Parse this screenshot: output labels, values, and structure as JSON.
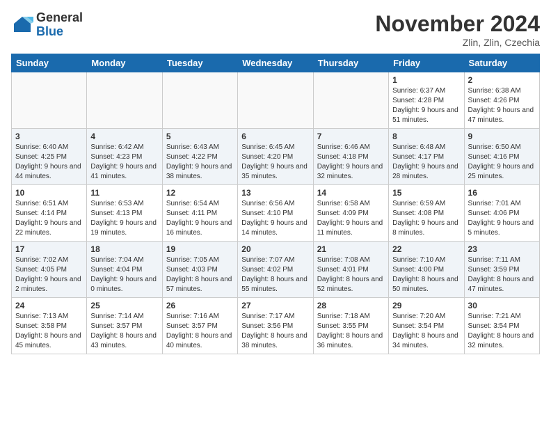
{
  "logo": {
    "general": "General",
    "blue": "Blue"
  },
  "title": "November 2024",
  "location": "Zlin, Zlin, Czechia",
  "days_of_week": [
    "Sunday",
    "Monday",
    "Tuesday",
    "Wednesday",
    "Thursday",
    "Friday",
    "Saturday"
  ],
  "weeks": [
    [
      {
        "day": "",
        "info": ""
      },
      {
        "day": "",
        "info": ""
      },
      {
        "day": "",
        "info": ""
      },
      {
        "day": "",
        "info": ""
      },
      {
        "day": "",
        "info": ""
      },
      {
        "day": "1",
        "info": "Sunrise: 6:37 AM\nSunset: 4:28 PM\nDaylight: 9 hours and 51 minutes."
      },
      {
        "day": "2",
        "info": "Sunrise: 6:38 AM\nSunset: 4:26 PM\nDaylight: 9 hours and 47 minutes."
      }
    ],
    [
      {
        "day": "3",
        "info": "Sunrise: 6:40 AM\nSunset: 4:25 PM\nDaylight: 9 hours and 44 minutes."
      },
      {
        "day": "4",
        "info": "Sunrise: 6:42 AM\nSunset: 4:23 PM\nDaylight: 9 hours and 41 minutes."
      },
      {
        "day": "5",
        "info": "Sunrise: 6:43 AM\nSunset: 4:22 PM\nDaylight: 9 hours and 38 minutes."
      },
      {
        "day": "6",
        "info": "Sunrise: 6:45 AM\nSunset: 4:20 PM\nDaylight: 9 hours and 35 minutes."
      },
      {
        "day": "7",
        "info": "Sunrise: 6:46 AM\nSunset: 4:18 PM\nDaylight: 9 hours and 32 minutes."
      },
      {
        "day": "8",
        "info": "Sunrise: 6:48 AM\nSunset: 4:17 PM\nDaylight: 9 hours and 28 minutes."
      },
      {
        "day": "9",
        "info": "Sunrise: 6:50 AM\nSunset: 4:16 PM\nDaylight: 9 hours and 25 minutes."
      }
    ],
    [
      {
        "day": "10",
        "info": "Sunrise: 6:51 AM\nSunset: 4:14 PM\nDaylight: 9 hours and 22 minutes."
      },
      {
        "day": "11",
        "info": "Sunrise: 6:53 AM\nSunset: 4:13 PM\nDaylight: 9 hours and 19 minutes."
      },
      {
        "day": "12",
        "info": "Sunrise: 6:54 AM\nSunset: 4:11 PM\nDaylight: 9 hours and 16 minutes."
      },
      {
        "day": "13",
        "info": "Sunrise: 6:56 AM\nSunset: 4:10 PM\nDaylight: 9 hours and 14 minutes."
      },
      {
        "day": "14",
        "info": "Sunrise: 6:58 AM\nSunset: 4:09 PM\nDaylight: 9 hours and 11 minutes."
      },
      {
        "day": "15",
        "info": "Sunrise: 6:59 AM\nSunset: 4:08 PM\nDaylight: 9 hours and 8 minutes."
      },
      {
        "day": "16",
        "info": "Sunrise: 7:01 AM\nSunset: 4:06 PM\nDaylight: 9 hours and 5 minutes."
      }
    ],
    [
      {
        "day": "17",
        "info": "Sunrise: 7:02 AM\nSunset: 4:05 PM\nDaylight: 9 hours and 2 minutes."
      },
      {
        "day": "18",
        "info": "Sunrise: 7:04 AM\nSunset: 4:04 PM\nDaylight: 9 hours and 0 minutes."
      },
      {
        "day": "19",
        "info": "Sunrise: 7:05 AM\nSunset: 4:03 PM\nDaylight: 8 hours and 57 minutes."
      },
      {
        "day": "20",
        "info": "Sunrise: 7:07 AM\nSunset: 4:02 PM\nDaylight: 8 hours and 55 minutes."
      },
      {
        "day": "21",
        "info": "Sunrise: 7:08 AM\nSunset: 4:01 PM\nDaylight: 8 hours and 52 minutes."
      },
      {
        "day": "22",
        "info": "Sunrise: 7:10 AM\nSunset: 4:00 PM\nDaylight: 8 hours and 50 minutes."
      },
      {
        "day": "23",
        "info": "Sunrise: 7:11 AM\nSunset: 3:59 PM\nDaylight: 8 hours and 47 minutes."
      }
    ],
    [
      {
        "day": "24",
        "info": "Sunrise: 7:13 AM\nSunset: 3:58 PM\nDaylight: 8 hours and 45 minutes."
      },
      {
        "day": "25",
        "info": "Sunrise: 7:14 AM\nSunset: 3:57 PM\nDaylight: 8 hours and 43 minutes."
      },
      {
        "day": "26",
        "info": "Sunrise: 7:16 AM\nSunset: 3:57 PM\nDaylight: 8 hours and 40 minutes."
      },
      {
        "day": "27",
        "info": "Sunrise: 7:17 AM\nSunset: 3:56 PM\nDaylight: 8 hours and 38 minutes."
      },
      {
        "day": "28",
        "info": "Sunrise: 7:18 AM\nSunset: 3:55 PM\nDaylight: 8 hours and 36 minutes."
      },
      {
        "day": "29",
        "info": "Sunrise: 7:20 AM\nSunset: 3:54 PM\nDaylight: 8 hours and 34 minutes."
      },
      {
        "day": "30",
        "info": "Sunrise: 7:21 AM\nSunset: 3:54 PM\nDaylight: 8 hours and 32 minutes."
      }
    ]
  ]
}
